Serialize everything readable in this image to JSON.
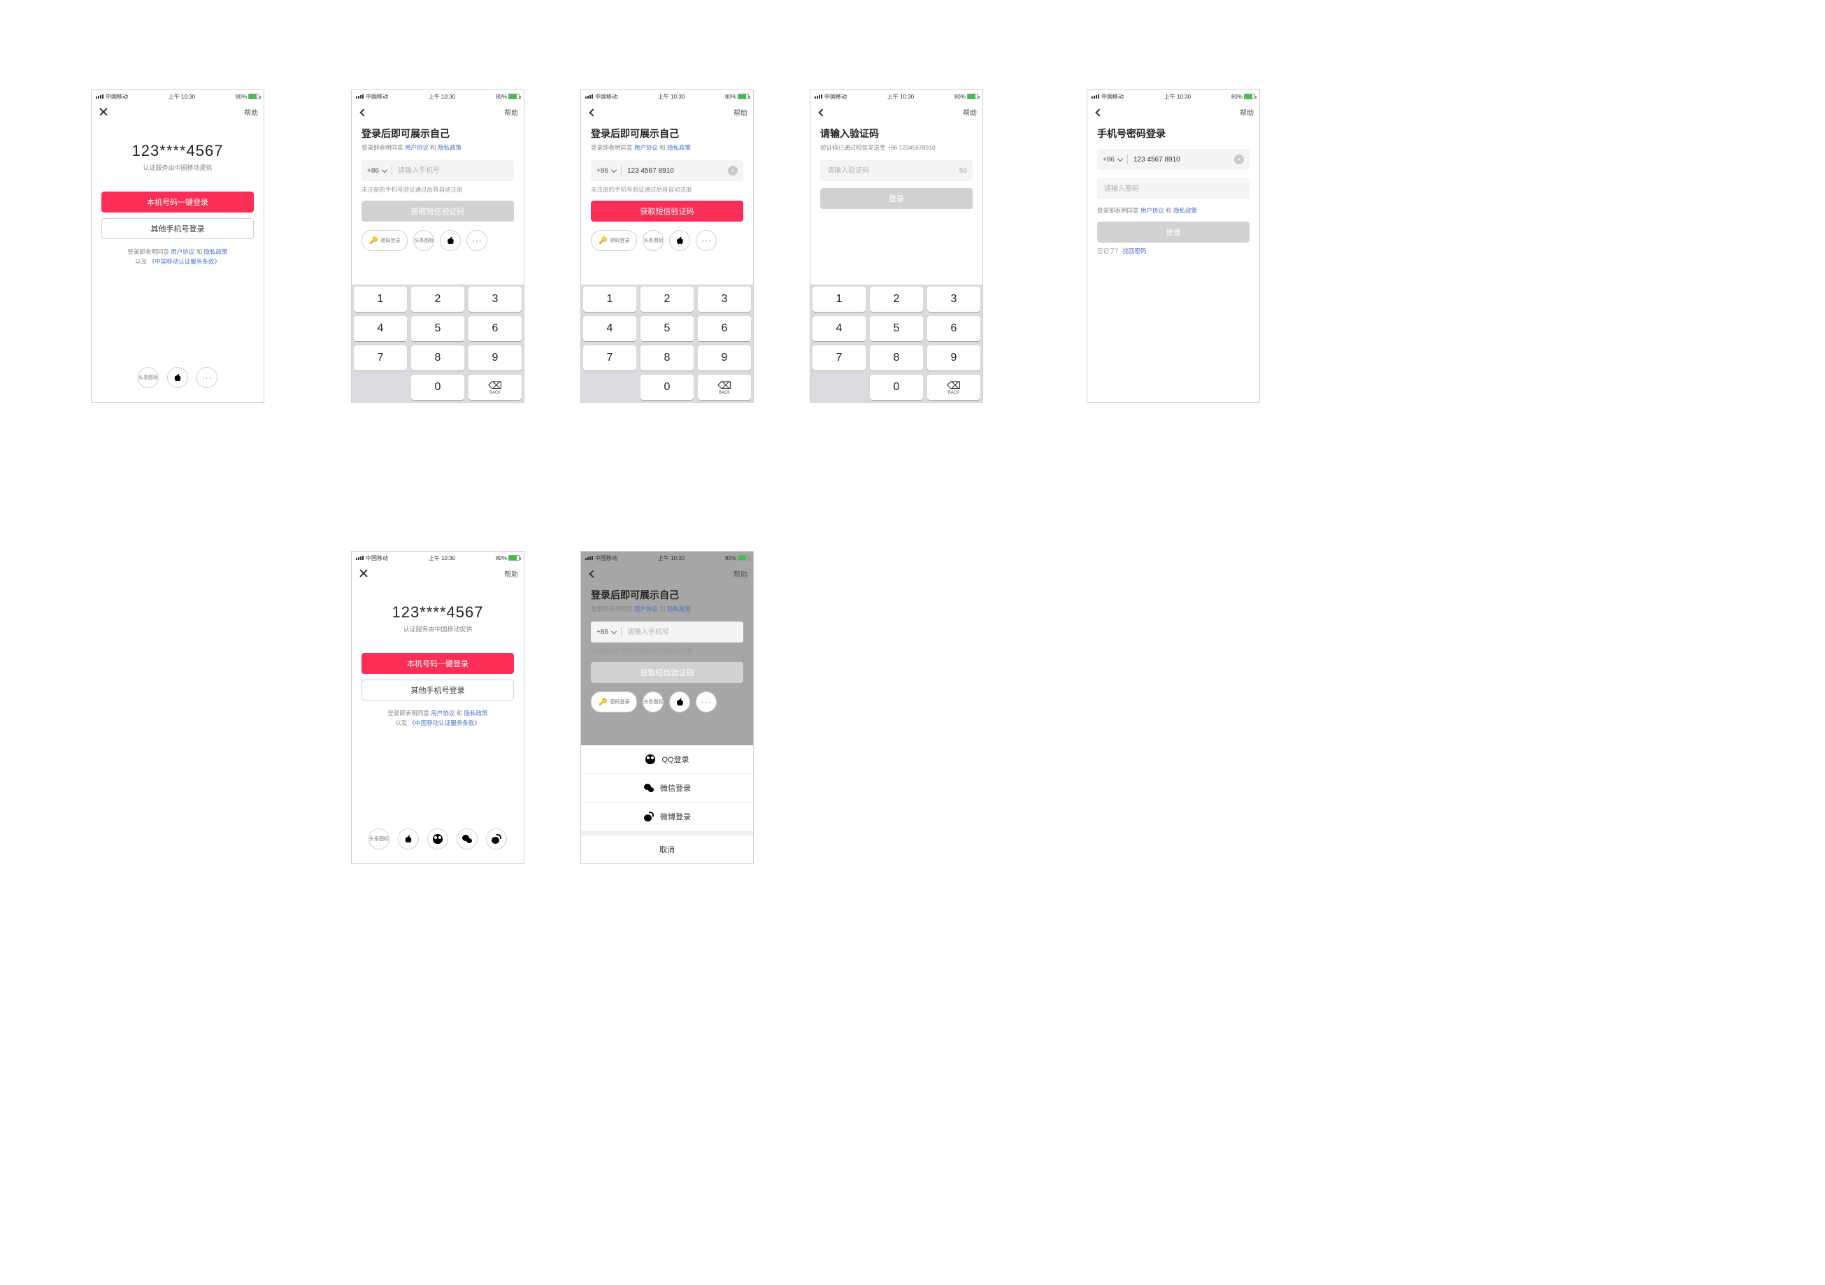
{
  "common": {
    "carrier": "中国移动",
    "time": "上午 10:30",
    "battery_pct": "80%",
    "help": "帮助",
    "country_code": "+86",
    "phone_placeholder": "请输入手机号",
    "agree_prefix": "登录即表明同意",
    "user_agreement": "用户协议",
    "and": "和",
    "privacy_policy": "隐私政策",
    "also": "以及",
    "cmcc_terms": "《中国移动认证服务条款》",
    "unreg_hint": "未注册的手机号验证通过后将自动注册",
    "get_sms_code": "获取短信验证码",
    "password_login": "密码登录",
    "alt_brand_icon": "头条图标",
    "more": "更多",
    "backspace": "BACK"
  },
  "s1": {
    "masked_phone": "123****4567",
    "auth_note": "认证服务由中国移动提供",
    "btn_one_tap": "本机号码一键登录",
    "btn_other": "其他手机号登录"
  },
  "s2": {
    "title": "登录后即可展示自己"
  },
  "s3": {
    "title": "登录后即可展示自己",
    "phone_value": "123 4567 8910"
  },
  "s4": {
    "title": "请输入验证码",
    "sent_note": "验证码已通过短信发送至 +86 12345678910",
    "code_placeholder": "请输入验证码",
    "countdown": "59",
    "login_btn": "登录"
  },
  "s5": {
    "title": "手机号密码登录",
    "phone_value": "123 4567 8910",
    "pwd_placeholder": "请输入密码",
    "login_btn": "登录",
    "forgot_prefix": "忘记了？",
    "forgot_link": "找回密码"
  },
  "s7": {
    "title": "登录后即可展示自己",
    "qq": "QQ登录",
    "wechat": "微信登录",
    "weibo": "微博登录",
    "cancel": "取消"
  }
}
